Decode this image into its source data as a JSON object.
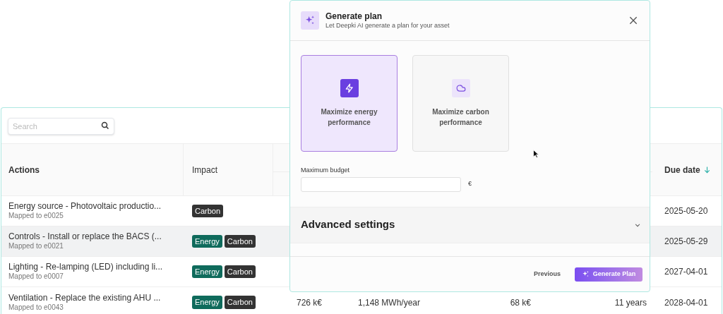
{
  "search": {
    "placeholder": "Search"
  },
  "table": {
    "columns": [
      "Actions",
      "Impact",
      "Due date"
    ],
    "rows": [
      {
        "action": "Energy source - Photovoltaic productio...",
        "mapped": "Mapped to e0025",
        "highlighted": false,
        "tags": [
          {
            "label": "Carbon",
            "kind": "carbon"
          }
        ],
        "due": "2025-05-20"
      },
      {
        "action": "Controls - Install or replace the BACS (...",
        "mapped": "Mapped to e0021",
        "highlighted": true,
        "tags": [
          {
            "label": "Energy",
            "kind": "energy"
          },
          {
            "label": "Carbon",
            "kind": "carbon"
          }
        ],
        "due": "2025-05-29"
      },
      {
        "action": "Lighting - Re-lamping (LED) including li...",
        "mapped": "Mapped to e0007",
        "highlighted": false,
        "tags": [
          {
            "label": "Energy",
            "kind": "energy"
          },
          {
            "label": "Carbon",
            "kind": "carbon"
          }
        ],
        "due": "2027-04-01"
      },
      {
        "action": "Ventilation - Replace the existing AHU ...",
        "mapped": "Mapped to e0043",
        "highlighted": false,
        "tags": [
          {
            "label": "Energy",
            "kind": "energy"
          },
          {
            "label": "Carbon",
            "kind": "carbon"
          }
        ],
        "cost": "726 k€",
        "energy": "1,148 MWh/year",
        "savings": "68 k€",
        "payback": "11 years",
        "due": "2028-04-01"
      }
    ]
  },
  "modal": {
    "title": "Generate plan",
    "subtitle": "Let Deepki AI generate a plan for your asset",
    "options": [
      {
        "label": "Maximize energy performance",
        "kind": "energy",
        "selected": true
      },
      {
        "label": "Maximize carbon performance",
        "kind": "carbon",
        "selected": false
      }
    ],
    "budget": {
      "label": "Maximum budget",
      "unit": "€"
    },
    "advanced": {
      "label": "Advanced settings",
      "expanded": false
    },
    "buttons": {
      "previous": "Previous",
      "generate": "Generate Plan"
    }
  }
}
